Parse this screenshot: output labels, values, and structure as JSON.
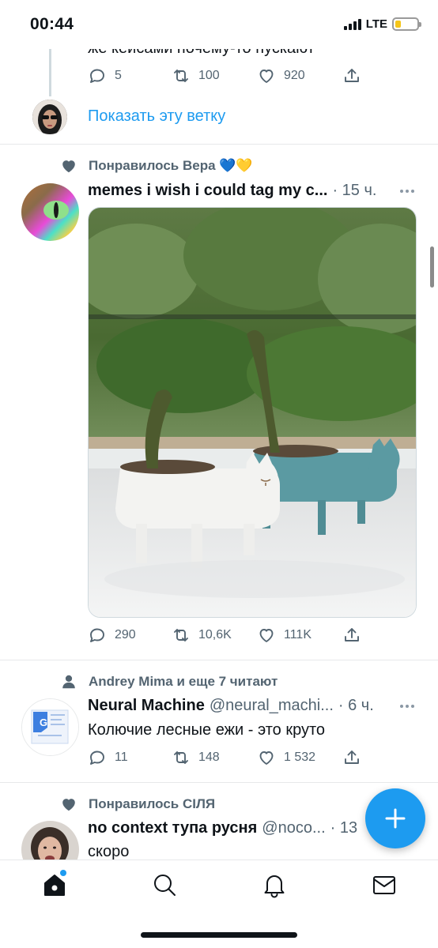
{
  "status_bar": {
    "time": "00:44",
    "network": "LTE",
    "battery_level": 0.25
  },
  "thread": {
    "cut_text": "же кейсами почему-то пускают",
    "replies": "5",
    "retweets": "100",
    "likes": "920",
    "show_thread": "Показать эту ветку"
  },
  "tweet1": {
    "context": "Понравилось Вера 💙💛",
    "name": "memes i wish i could tag my c...",
    "meta": "· 15 ч.",
    "replies": "290",
    "retweets": "10,6K",
    "likes": "111K",
    "media_icon": "cat-cactus-planters-photo"
  },
  "tweet2": {
    "context": "Andrey Mima и еще 7 читают",
    "name": "Neural Machine",
    "handle": "@neural_machi...",
    "meta": "· 6 ч.",
    "text": "Колючие лесные ежи - это круто",
    "replies": "11",
    "retweets": "148",
    "likes": "1 532"
  },
  "tweet3": {
    "context": "Понравилось СIЛЯ",
    "name": "no context тупа русня",
    "handle": "@noco...",
    "meta": "· 13",
    "text": "скоро"
  },
  "tabbar": {
    "items": [
      "home-icon",
      "search-icon",
      "notifications-icon",
      "messages-icon"
    ]
  },
  "colors": {
    "accent": "#1d9bf0",
    "text": "#0f1419",
    "secondary": "#536471"
  }
}
